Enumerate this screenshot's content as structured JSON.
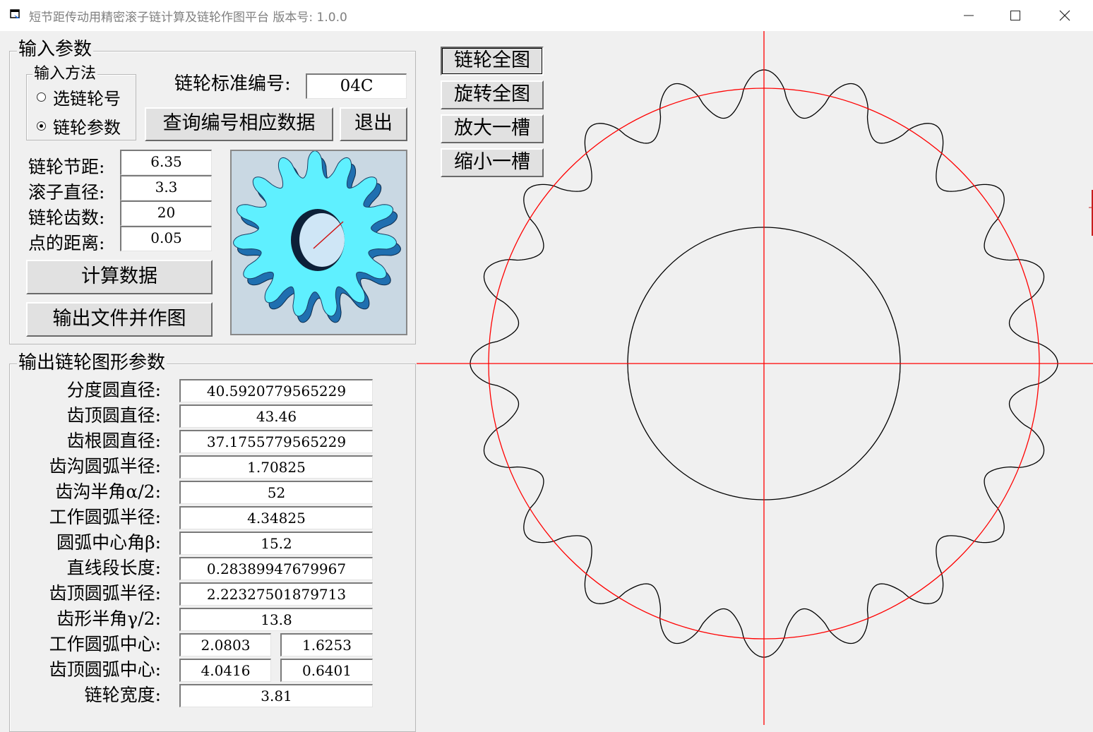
{
  "window": {
    "title": "短节距传动用精密滚子链计算及链轮作图平台   版本号: 1.0.0",
    "minimize_icon": "minimize-icon",
    "maximize_icon": "maximize-icon",
    "close_icon": "close-icon"
  },
  "input_group": {
    "legend": "输入参数",
    "method": {
      "legend": "输入方法",
      "options": [
        {
          "label": "选链轮号",
          "checked": false
        },
        {
          "label": "链轮参数",
          "checked": true
        }
      ]
    },
    "standard_no_label": "链轮标准编号:",
    "standard_no_value": "04C",
    "query_button": "查询编号相应数据",
    "exit_button": "退出",
    "params": [
      {
        "label": "链轮节距:",
        "value": "6.35"
      },
      {
        "label": "滚子直径:",
        "value": "3.3"
      },
      {
        "label": "链轮齿数:",
        "value": "20"
      },
      {
        "label": "点的距离:",
        "value": "0.05"
      }
    ],
    "calc_button": "计算数据",
    "output_button": "输出文件并作图"
  },
  "output_group": {
    "legend": "输出链轮图形参数",
    "rows": [
      {
        "label": "分度圆直径:",
        "value": "40.5920779565229"
      },
      {
        "label": "齿顶圆直径:",
        "value": "43.46"
      },
      {
        "label": "齿根圆直径:",
        "value": "37.1755779565229"
      },
      {
        "label": "齿沟圆弧半径:",
        "value": "1.70825"
      },
      {
        "label": "齿沟半角α/2:",
        "value": "52"
      },
      {
        "label": "工作圆弧半径:",
        "value": "4.34825"
      },
      {
        "label": "圆弧中心角β:",
        "value": "15.2"
      },
      {
        "label": "直线段长度:",
        "value": "0.28389947679967"
      },
      {
        "label": "齿顶圆弧半径:",
        "value": "2.22327501879713"
      },
      {
        "label": "齿形半角γ/2:",
        "value": "13.8"
      },
      {
        "label": "工作圆弧中心:",
        "value": "2.0803",
        "value2": "1.6253"
      },
      {
        "label": "齿顶圆弧中心:",
        "value": "4.0416",
        "value2": "0.6401"
      },
      {
        "label": "链轮宽度:",
        "value": "3.81"
      }
    ]
  },
  "view_buttons": [
    "链轮全图",
    "旋转全图",
    "放大一槽",
    "缩小一槽"
  ],
  "drawing": {
    "teeth": 20,
    "pitch_circle_color": "#ff0000",
    "axis_color": "#ff0000",
    "profile_color": "#000000"
  },
  "preview": {
    "icon": "sprocket-3d-icon",
    "sprocket_color": "#5ff0ff",
    "shadow_color": "#1f6fb0",
    "background": "#c9d8e3"
  }
}
